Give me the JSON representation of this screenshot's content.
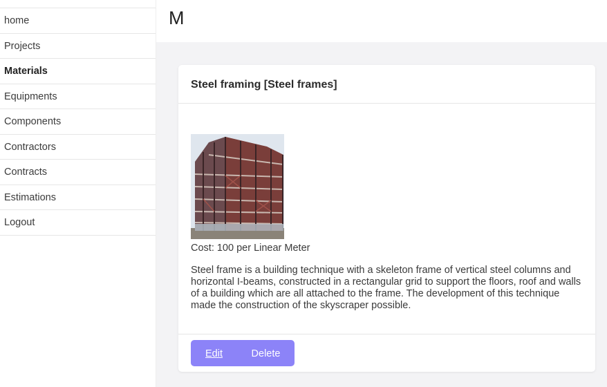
{
  "sidebar": {
    "items": [
      {
        "label": "home"
      },
      {
        "label": "Projects"
      },
      {
        "label": "Materials"
      },
      {
        "label": "Equipments"
      },
      {
        "label": "Components"
      },
      {
        "label": "Contractors"
      },
      {
        "label": "Contracts"
      },
      {
        "label": "Estimations"
      },
      {
        "label": "Logout"
      }
    ],
    "active": "Materials"
  },
  "header": {
    "title": "M"
  },
  "material": {
    "title": "Steel framing [Steel frames]",
    "cost": "Cost: 100 per Linear Meter",
    "description": "Steel frame is a building technique with a skeleton frame of vertical steel columns and horizontal I-beams, constructed in a rectangular grid to support the floors, roof and walls of a building which are all attached to the frame. The development of this technique made the construction of the skyscraper possible.",
    "image_subject": "steel-frame-building-photo"
  },
  "actions": {
    "edit_label": "Edit",
    "delete_label": "Delete"
  },
  "colors": {
    "accent": "#8c83f8",
    "content_bg": "#f3f3f5"
  }
}
